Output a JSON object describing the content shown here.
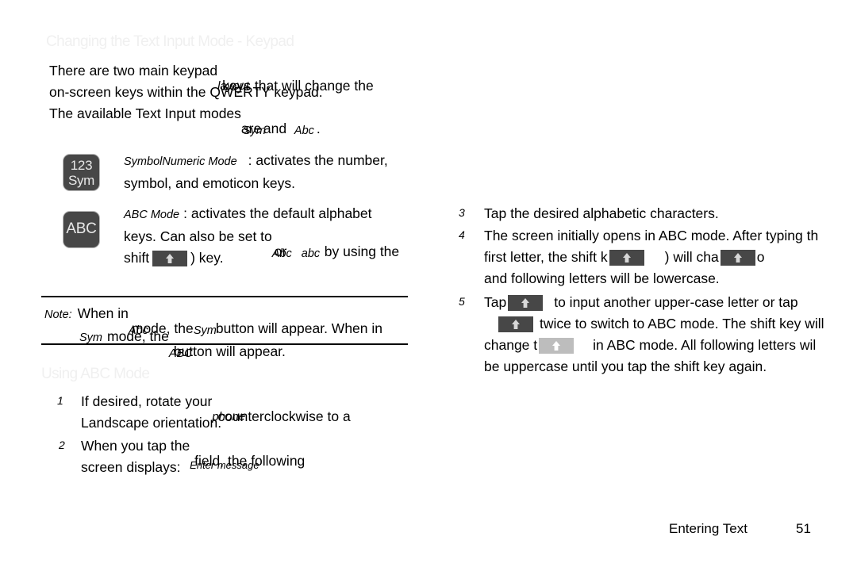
{
  "page": {
    "section1_heading": "Changing the Text Input Mode - Keypad",
    "section2_heading": "Using ABC Mode",
    "intro": {
      "line1_a": "There are two main keypad",
      "line1_b": "layout",
      "line1_c": "keys that will change the",
      "line2": "on-screen keys within the QWERTY keypad.",
      "line3_a": "The available Text Input modes",
      "line3_b": "are",
      "line3_c": "Sym",
      "line3_d": "and",
      "line3_e": "Abc",
      "line3_f": "."
    },
    "key_sym": {
      "line1": "123",
      "line2": "Sym"
    },
    "key_abc": {
      "label": "ABC"
    },
    "bullet_sym": {
      "term_a": "Symbol",
      "term_b": "Numeric Mode",
      "rest_line1": ": activates the number,",
      "line2": "symbol, and emoticon keys."
    },
    "bullet_abc": {
      "term": "ABC Mode",
      "rest_line1": ": activates the default alphabet",
      "line2_a": "keys. Can also be set to",
      "line2_b": "Abc",
      "line2_c": "or",
      "line2_d": "abc",
      "line2_e": "by using the",
      "line3_a": "shift",
      "line3_b": ") key."
    },
    "note": {
      "label": "Note:",
      "line1_a": "When in",
      "line1_b": "Abc",
      "line1_c": "mode, the",
      "line1_d": "Sym",
      "line1_e": "button will appear. When in",
      "line2_a": "Sym",
      "line2_b": "mode, the",
      "line2_c": "ABC",
      "line2_d": "button will appear."
    },
    "steps_left": [
      {
        "num": "1",
        "line1_a": "If desired, rotate your",
        "line1_b": "phone",
        "line1_c": "counterclockwise to a",
        "line2": "Landscape orientation."
      },
      {
        "num": "2",
        "line1_a": "When you tap the",
        "line1_b": "Enter message",
        "line1_c": "field, the following",
        "line2": "screen displays:"
      }
    ],
    "steps_right": [
      {
        "num": "3",
        "line1": "Tap the desired alphabetic characters."
      },
      {
        "num": "4",
        "line1": "The screen initially opens in ABC mode. After typing th",
        "line2_a": "first letter, the shift k",
        "line2_b": ") will cha",
        "line2_c": "o",
        "line3": "and following letters will be lowercase."
      },
      {
        "num": "5",
        "line1_a": "Tap",
        "line1_b": "to input another upper-case letter or tap",
        "line2_a": "twice to switch to ABC mode. The shift key will",
        "line3_a": "change t",
        "line3_b": "in ABC mode. All following letters wil",
        "line4": "be uppercase until you tap the shift key again."
      }
    ],
    "footer": {
      "chapter": "Entering Text",
      "page_number": "51"
    },
    "colors": {
      "heading": "#f0f0f0",
      "key_dark": "#474747",
      "key_light": "#bdbdbd",
      "key_border": "#b9b9b9",
      "text": "#000000",
      "arrow_fill": "#d8d8d8"
    }
  }
}
